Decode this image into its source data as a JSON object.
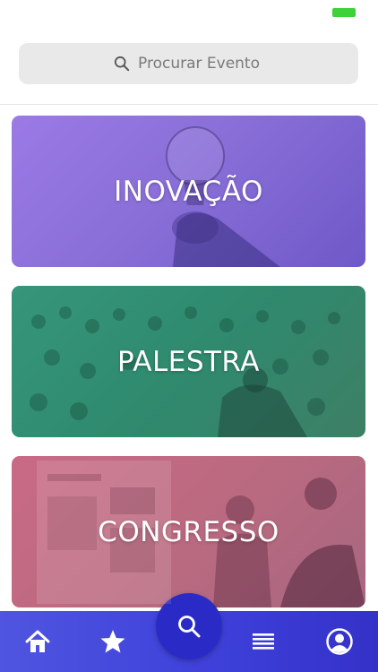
{
  "status_bar": {
    "battery_color": "#3ed23a"
  },
  "search": {
    "placeholder": "Procurar Evento",
    "value": ""
  },
  "categories": [
    {
      "label": "INOVAÇÃO",
      "color": "#8a6fd8"
    },
    {
      "label": "PALESTRA",
      "color": "#2f8a6e"
    },
    {
      "label": "CONGRESSO",
      "color": "#bb6a80"
    }
  ],
  "tab_bar": {
    "accent": "#3d3fd9",
    "items": [
      {
        "icon": "home-icon"
      },
      {
        "icon": "star-icon"
      },
      {
        "icon": "search-icon"
      },
      {
        "icon": "list-icon"
      },
      {
        "icon": "profile-icon"
      }
    ]
  }
}
